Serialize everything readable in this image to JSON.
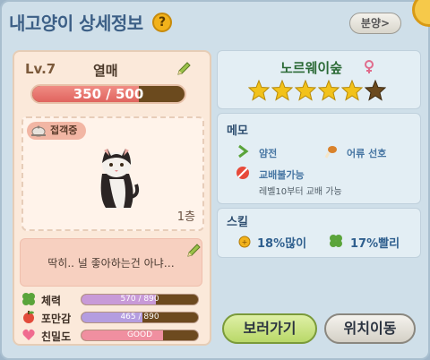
{
  "header": {
    "title": "내고양이 상세정보",
    "help_icon": "question-mark-icon",
    "help_label": "?",
    "share_label": "분양>"
  },
  "cat": {
    "level": "Lv.7",
    "name": "열매",
    "exp_text": "350 / 500",
    "exp_ratio": 0.7,
    "status_badge": "접객중",
    "floor": "1층",
    "speech": "딱히.. 널 좋아하는건 아냐…"
  },
  "stats": [
    {
      "label": "체력",
      "text": "570 / 890",
      "ratio": 0.64,
      "color": "#c89ad8",
      "icon": "clover-icon"
    },
    {
      "label": "포만감",
      "text": "465 / 890",
      "ratio": 0.52,
      "color": "#b49de0",
      "icon": "apple-icon"
    },
    {
      "label": "친밀도",
      "text": "GOOD",
      "ratio": 0.7,
      "color": "#f08fa0",
      "icon": "heart-icon"
    }
  ],
  "breed": {
    "name": "노르웨이숲",
    "gender_icon": "female-icon",
    "rating": 5,
    "max_rating": 6
  },
  "memo": {
    "title": "메모",
    "personality": "얌전",
    "preference": "어류 선호",
    "trade": "교배불가능",
    "trade_note": "레벨10부터 교배 가능"
  },
  "skill": {
    "title": "스킬",
    "skill1": "18%많이",
    "skill2": "17%빨리"
  },
  "buttons": {
    "view": "보러가기",
    "move": "위치이동"
  },
  "colors": {
    "title": "#3c5f86",
    "breed": "#2b6a36",
    "star": "#f2c21b",
    "star_empty": "#6b4a1e"
  }
}
